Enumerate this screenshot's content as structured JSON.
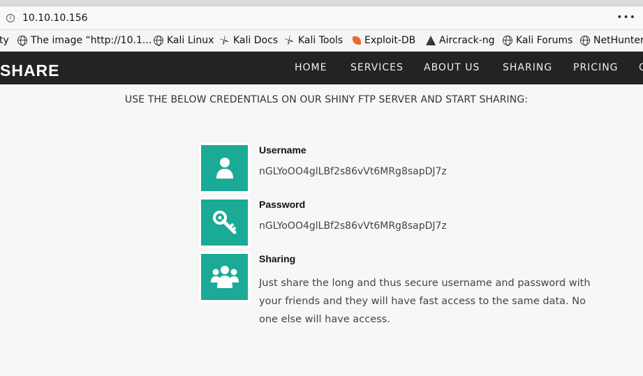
{
  "browser": {
    "url": "10.10.10.156",
    "menu_glyph": "•••"
  },
  "bookmarks": [
    {
      "label": "ty",
      "icon": "none"
    },
    {
      "label": "The image “http://10.1...",
      "icon": "globe-icon"
    },
    {
      "label": "Kali Linux",
      "icon": "globe-icon"
    },
    {
      "label": "Kali Docs",
      "icon": "kali-dragon-icon"
    },
    {
      "label": "Kali Tools",
      "icon": "kali-dragon-icon"
    },
    {
      "label": "Exploit-DB",
      "icon": "exploit-db-icon"
    },
    {
      "label": "Aircrack-ng",
      "icon": "aircrack-icon"
    },
    {
      "label": "Kali Forums",
      "icon": "globe-icon"
    },
    {
      "label": "NetHunter",
      "icon": "globe-icon"
    }
  ],
  "navbar": {
    "brand": "SHARE",
    "items": [
      "HOME",
      "SERVICES",
      "ABOUT US",
      "SHARING",
      "PRICING",
      "C"
    ]
  },
  "main": {
    "instructions": "USE THE BELOW CREDENTIALS ON OUR SHINY FTP SERVER AND START SHARING:",
    "username": {
      "title": "Username",
      "value": "nGLYoOO4glLBf2s86vVt6MRg8sapDJ7z",
      "icon": "user-icon"
    },
    "password": {
      "title": "Password",
      "value": "nGLYoOO4glLBf2s86vVt6MRg8sapDJ7z",
      "icon": "key-icon"
    },
    "sharing": {
      "title": "Sharing",
      "description": "Just share the long and thus secure username and password with your friends and they will have fast access to the same data. No one else will have access.",
      "icon": "users-icon"
    }
  },
  "colors": {
    "accent": "#1aaa96",
    "navbar": "#232323",
    "background": "#f7f7f7"
  }
}
